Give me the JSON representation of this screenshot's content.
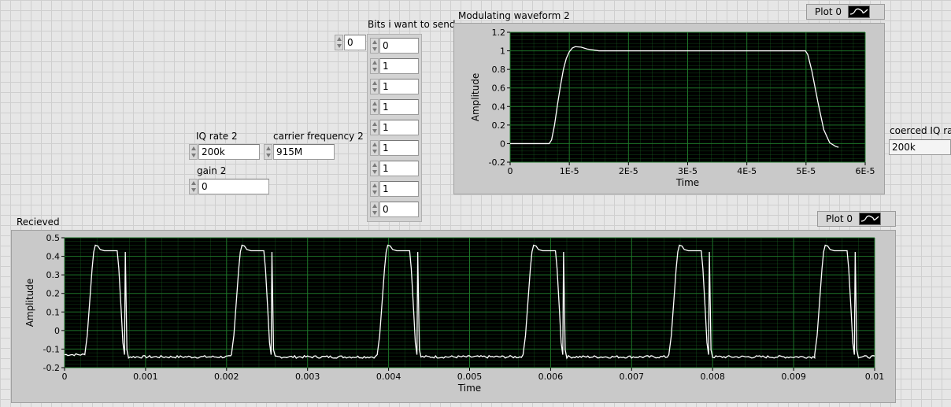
{
  "controls": {
    "iq_rate": {
      "label": "IQ rate 2",
      "value": "200k"
    },
    "carrier_frequency": {
      "label": "carrier frequency 2",
      "value": "915M"
    },
    "gain": {
      "label": "gain 2",
      "value": "0"
    },
    "coerced_iq_rate": {
      "label": "coerced IQ rate",
      "value": "200k"
    }
  },
  "bits_array": {
    "label": "Bits i want to send",
    "index": "0",
    "values": [
      "0",
      "1",
      "1",
      "1",
      "1",
      "1",
      "1",
      "1",
      "0"
    ]
  },
  "graphs": {
    "modulating": {
      "title": "Modulating waveform 2",
      "legend": "Plot 0"
    },
    "received": {
      "title": "Recieved",
      "legend": "Plot 0"
    }
  },
  "chart_data": [
    {
      "type": "line",
      "title": "Modulating waveform 2",
      "xlabel": "Time",
      "ylabel": "Amplitude",
      "xlim": [
        0,
        6e-05
      ],
      "ylim": [
        -0.2,
        1.2
      ],
      "x_ticks": [
        "0",
        "1E-5",
        "2E-5",
        "3E-5",
        "4E-5",
        "5E-5",
        "6E-5"
      ],
      "y_ticks": [
        "-0.2",
        "0",
        "0.2",
        "0.4",
        "0.6",
        "0.8",
        "1",
        "1.2"
      ],
      "grid": true,
      "legend_position": "top-right",
      "colors": {
        "plot_bg": "#000000",
        "grid": "#1f7a2a",
        "line": "#ffffff"
      },
      "series": [
        {
          "name": "Plot 0",
          "x": [
            0,
            6.6e-06,
            7e-06,
            7.5e-06,
            8e-06,
            8.5e-06,
            9e-06,
            9.5e-06,
            1e-05,
            1.05e-05,
            1.1e-05,
            1.2e-05,
            1.3e-05,
            1.4e-05,
            1.5e-05,
            1.6e-05,
            1.8e-05,
            2e-05,
            3e-05,
            4e-05,
            4.99e-05,
            5.03e-05,
            5.1e-05,
            5.2e-05,
            5.3e-05,
            5.4e-05,
            5.5e-05,
            5.55e-05
          ],
          "y": [
            0,
            0,
            0.04,
            0.2,
            0.42,
            0.62,
            0.8,
            0.92,
            0.99,
            1.03,
            1.045,
            1.04,
            1.02,
            1.01,
            1.0,
            1.0,
            1.0,
            1.0,
            1.0,
            1.0,
            1.0,
            0.96,
            0.78,
            0.45,
            0.15,
            0.01,
            -0.03,
            -0.04
          ]
        }
      ]
    },
    {
      "type": "line",
      "title": "Recieved",
      "xlabel": "Time",
      "ylabel": "Amplitude",
      "xlim": [
        0,
        0.01
      ],
      "ylim": [
        -0.2,
        0.5
      ],
      "x_ticks": [
        "0",
        "0.001",
        "0.002",
        "0.003",
        "0.004",
        "0.005",
        "0.006",
        "0.007",
        "0.008",
        "0.009",
        "0.01"
      ],
      "y_ticks": [
        "-0.2",
        "-0.1",
        "0",
        "0.1",
        "0.2",
        "0.3",
        "0.4",
        "0.5"
      ],
      "grid": true,
      "legend_position": "top-right",
      "colors": {
        "plot_bg": "#000000",
        "grid": "#1f7a2a",
        "line": "#ffffff"
      },
      "series": [
        {
          "name": "Plot 0",
          "pulse_starts": [
            0.00025,
            0.00206,
            0.00386,
            0.00566,
            0.00746,
            0.00926
          ],
          "baseline": -0.13,
          "high": 0.43,
          "peak": 0.46
        }
      ]
    }
  ]
}
